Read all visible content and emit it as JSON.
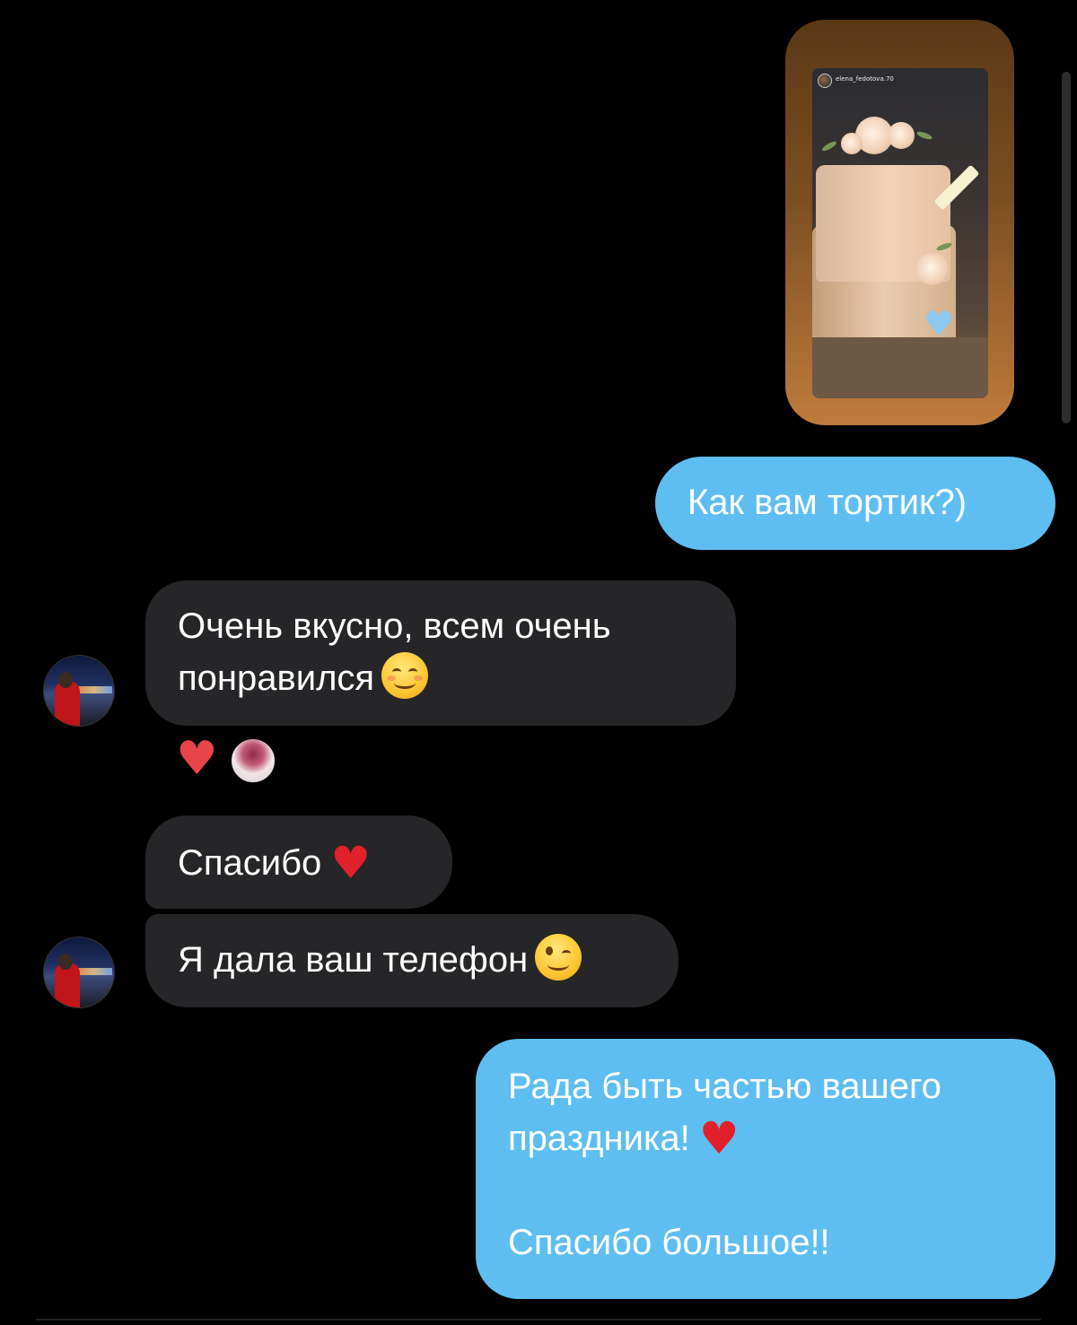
{
  "story": {
    "username": "elena_fedotova.70",
    "accent": "#7c4f22"
  },
  "messages": {
    "out_1": "Как вам тортик?)",
    "in_1_line1": "Очень вкусно, всем очень",
    "in_1_line2": "понравился",
    "in_2": "Спасибо",
    "in_3": "Я дала ваш телефон",
    "out_2_line1": "Рада быть частью вашего",
    "out_2_line2": "праздника!",
    "out_2_line3": "Спасибо большое!!"
  },
  "reactions": {
    "emoji": "heart"
  },
  "colors": {
    "outgoing_bubble": "#5fbef1",
    "incoming_bubble": "#262628",
    "background": "#000000",
    "heart": "#e0202a"
  },
  "icons": {
    "smile": "smiling-face-emoji",
    "wink": "winking-face-emoji",
    "heart": "red-heart-emoji"
  }
}
